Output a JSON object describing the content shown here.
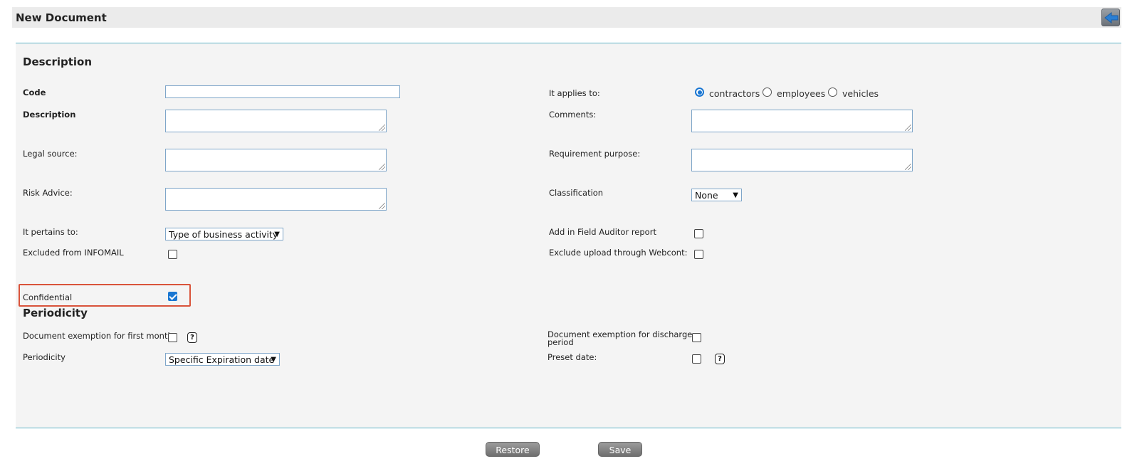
{
  "window": {
    "title": "New Document"
  },
  "description_section": {
    "title": "Description",
    "code_label": "Code",
    "code_value": "",
    "description_label": "Description",
    "legal_source_label": "Legal source:",
    "risk_advice_label": "Risk Advice:",
    "pertains_label": "It pertains to:",
    "pertains_value": "Type of business activity",
    "excluded_infomail_label": "Excluded from INFOMAIL",
    "confidential_label": "Confidential",
    "applies_label": "It applies to:",
    "applies_options": [
      "contractors",
      "employees",
      "vehicles"
    ],
    "applies_selected": "contractors",
    "comments_label": "Comments:",
    "requirement_purpose_label": "Requirement purpose:",
    "classification_label": "Classification",
    "classification_value": "None",
    "field_auditor_label": "Add in Field Auditor report",
    "exclude_webcont_label": "Exclude upload through Webcont:"
  },
  "periodicity_section": {
    "title": "Periodicity",
    "first_month_label": "Document exemption for first month",
    "periodicity_label": "Periodicity",
    "periodicity_value": "Specific Expiration date",
    "discharge_label_line1": "Document exemption for discharge",
    "discharge_label_line2": "period",
    "preset_date_label": "Preset date:",
    "help_glyph": "?"
  },
  "checkbox_states": {
    "excluded_infomail": false,
    "confidential": true,
    "field_auditor": false,
    "exclude_webcont": false,
    "first_month": false,
    "discharge": false,
    "preset_date": false
  },
  "buttons": {
    "restore": "Restore",
    "save": "Save"
  },
  "icons": {
    "back": "back-arrow-icon",
    "help": "help-icon",
    "dropdown": "chevron-down-icon"
  },
  "colors": {
    "accent": "#1976d2",
    "border": "#5fb3c6",
    "highlight": "#d9533a"
  }
}
